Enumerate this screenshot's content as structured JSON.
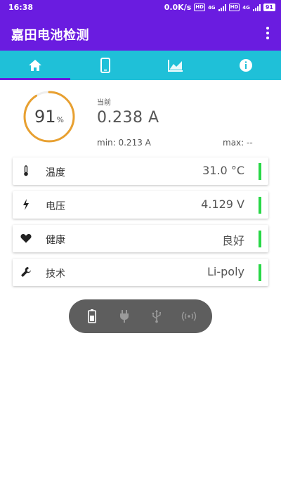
{
  "status_bar": {
    "time": "16:38",
    "net_speed": "0.0K/s",
    "hd1": "HD",
    "net1": "4G",
    "hd2": "HD",
    "net2": "4G",
    "battery": "91"
  },
  "app_bar": {
    "title": "嘉田电池检测",
    "menu_icon": "more-vert-icon"
  },
  "tabs": [
    {
      "icon": "home-icon",
      "active": true
    },
    {
      "icon": "phone-icon",
      "active": false
    },
    {
      "icon": "chart-icon",
      "active": false
    },
    {
      "icon": "info-icon",
      "active": false
    }
  ],
  "battery_gauge": {
    "percent": 91,
    "percent_text": "91",
    "unit": "%"
  },
  "current": {
    "label": "当前",
    "value": "0.238 A",
    "min": "min: 0.213 A",
    "max": "max: --"
  },
  "cards": [
    {
      "icon": "thermometer-icon",
      "label": "温度",
      "value": "31.0 °C"
    },
    {
      "icon": "lightning-icon",
      "label": "电压",
      "value": "4.129 V"
    },
    {
      "icon": "heart-icon",
      "label": "健康",
      "value": "良好"
    },
    {
      "icon": "wrench-icon",
      "label": "技术",
      "value": "Li-poly"
    }
  ],
  "charge_modes": [
    {
      "icon": "battery-icon",
      "active": true
    },
    {
      "icon": "plug-icon",
      "active": false
    },
    {
      "icon": "usb-icon",
      "active": false
    },
    {
      "icon": "wireless-icon",
      "active": false
    }
  ],
  "colors": {
    "primary": "#6a1ce0",
    "tab_bar": "#1fc0d8",
    "gauge_arc": "#e8a030",
    "status_ok": "#28d746",
    "pill_bg": "#5e5e5e"
  }
}
